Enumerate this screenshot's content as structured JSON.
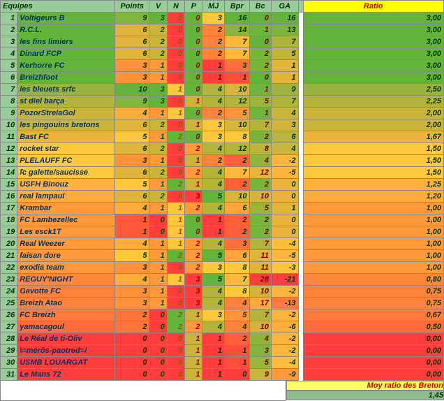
{
  "headers": {
    "equipes": "Equipes",
    "points": "Points",
    "v": "V",
    "n": "N",
    "p": "P",
    "mj": "MJ",
    "bpr": "Bpr",
    "bc": "Bc",
    "ga": "GA",
    "ratio": "Ratio"
  },
  "footer": {
    "label": "Moy ratio des Breton",
    "value": "1,45"
  },
  "rows": [
    {
      "n": 1,
      "team": "Voltigeurs B",
      "pts": 9,
      "v": 3,
      "nul": 0,
      "p": 0,
      "mj": 3,
      "bpr": 16,
      "bc": 0,
      "ga": 16,
      "ratio": "3,00"
    },
    {
      "n": 2,
      "team": "R.C.L.",
      "pts": 6,
      "v": 2,
      "nul": 0,
      "p": 0,
      "mj": 2,
      "bpr": 14,
      "bc": 1,
      "ga": 13,
      "ratio": "3,00"
    },
    {
      "n": 3,
      "team": "les fins limiers",
      "pts": 6,
      "v": 2,
      "nul": 0,
      "p": 0,
      "mj": 2,
      "bpr": 7,
      "bc": 0,
      "ga": 7,
      "ratio": "3,00"
    },
    {
      "n": 4,
      "team": "Dinard FCP",
      "pts": 6,
      "v": 2,
      "nul": 0,
      "p": 0,
      "mj": 2,
      "bpr": 7,
      "bc": 2,
      "ga": 5,
      "ratio": "3,00"
    },
    {
      "n": 5,
      "team": "Kerhorre FC",
      "pts": 3,
      "v": 1,
      "nul": 0,
      "p": 0,
      "mj": 1,
      "bpr": 3,
      "bc": 2,
      "ga": 1,
      "ratio": "3,00"
    },
    {
      "n": 6,
      "team": "Breizhfoot",
      "pts": 3,
      "v": 1,
      "nul": 0,
      "p": 0,
      "mj": 1,
      "bpr": 1,
      "bc": 0,
      "ga": 1,
      "ratio": "3,00"
    },
    {
      "n": 7,
      "team": "les bleuets srfc",
      "pts": 10,
      "v": 3,
      "nul": 1,
      "p": 0,
      "mj": 4,
      "bpr": 10,
      "bc": 1,
      "ga": 9,
      "ratio": "2,50"
    },
    {
      "n": 8,
      "team": "st diel barça",
      "pts": 9,
      "v": 3,
      "nul": 0,
      "p": 1,
      "mj": 4,
      "bpr": 12,
      "bc": 5,
      "ga": 7,
      "ratio": "2,25"
    },
    {
      "n": 9,
      "team": "PozorStrelaGol",
      "pts": 4,
      "v": 1,
      "nul": 1,
      "p": 0,
      "mj": 2,
      "bpr": 5,
      "bc": 1,
      "ga": 4,
      "ratio": "2,00"
    },
    {
      "n": 10,
      "team": "les pingouins bretons",
      "pts": 6,
      "v": 2,
      "nul": 0,
      "p": 1,
      "mj": 3,
      "bpr": 10,
      "bc": 7,
      "ga": 3,
      "ratio": "2,00"
    },
    {
      "n": 11,
      "team": "Bast FC",
      "pts": 5,
      "v": 1,
      "nul": 2,
      "p": 0,
      "mj": 3,
      "bpr": 8,
      "bc": 2,
      "ga": 6,
      "ratio": "1,67"
    },
    {
      "n": 12,
      "team": "rocket star",
      "pts": 6,
      "v": 2,
      "nul": 0,
      "p": 2,
      "mj": 4,
      "bpr": 12,
      "bc": 8,
      "ga": 4,
      "ratio": "1,50"
    },
    {
      "n": 13,
      "team": "PLELAUFF FC",
      "pts": 3,
      "v": 1,
      "nul": 0,
      "p": 1,
      "mj": 2,
      "bpr": 2,
      "bc": 4,
      "ga": -2,
      "ratio": "1,50"
    },
    {
      "n": 14,
      "team": "fc galette/saucisse",
      "pts": 6,
      "v": 2,
      "nul": 0,
      "p": 2,
      "mj": 4,
      "bpr": 7,
      "bc": 12,
      "ga": -5,
      "ratio": "1,50"
    },
    {
      "n": 15,
      "team": "USFH Binouz",
      "pts": 5,
      "v": 1,
      "nul": 2,
      "p": 1,
      "mj": 4,
      "bpr": 2,
      "bc": 2,
      "ga": 0,
      "ratio": "1,25"
    },
    {
      "n": 16,
      "team": "real lampaul",
      "pts": 6,
      "v": 2,
      "nul": 0,
      "p": 3,
      "mj": 5,
      "bpr": 10,
      "bc": 10,
      "ga": 0,
      "ratio": "1,20"
    },
    {
      "n": 17,
      "team": "Krambar",
      "pts": 4,
      "v": 1,
      "nul": 1,
      "p": 2,
      "mj": 4,
      "bpr": 6,
      "bc": 5,
      "ga": 1,
      "ratio": "1,00"
    },
    {
      "n": 18,
      "team": "FC Lambezellec",
      "pts": 1,
      "v": 0,
      "nul": 1,
      "p": 0,
      "mj": 1,
      "bpr": 2,
      "bc": 2,
      "ga": 0,
      "ratio": "1,00"
    },
    {
      "n": 19,
      "team": "Les esck1T",
      "pts": 1,
      "v": 0,
      "nul": 1,
      "p": 0,
      "mj": 1,
      "bpr": 2,
      "bc": 2,
      "ga": 0,
      "ratio": "1,00"
    },
    {
      "n": 20,
      "team": "Real Weezer",
      "pts": 4,
      "v": 1,
      "nul": 1,
      "p": 2,
      "mj": 4,
      "bpr": 3,
      "bc": 7,
      "ga": -4,
      "ratio": "1,00"
    },
    {
      "n": 21,
      "team": "faisan dore",
      "pts": 5,
      "v": 1,
      "nul": 2,
      "p": 2,
      "mj": 5,
      "bpr": 6,
      "bc": 11,
      "ga": -5,
      "ratio": "1,00"
    },
    {
      "n": 22,
      "team": "exodia team",
      "pts": 3,
      "v": 1,
      "nul": 0,
      "p": 2,
      "mj": 3,
      "bpr": 8,
      "bc": 11,
      "ga": -3,
      "ratio": "1,00"
    },
    {
      "n": 23,
      "team": "REGUY'NIGHT",
      "pts": 4,
      "v": 1,
      "nul": 1,
      "p": 3,
      "mj": 5,
      "bpr": 7,
      "bc": 28,
      "ga": -21,
      "ratio": "0,80"
    },
    {
      "n": 24,
      "team": "Gavotte FC",
      "pts": 3,
      "v": 1,
      "nul": 0,
      "p": 3,
      "mj": 4,
      "bpr": 8,
      "bc": 10,
      "ga": -2,
      "ratio": "0,75"
    },
    {
      "n": 25,
      "team": "Breizh Atao",
      "pts": 3,
      "v": 1,
      "nul": 0,
      "p": 3,
      "mj": 4,
      "bpr": 4,
      "bc": 17,
      "ga": -13,
      "ratio": "0,75"
    },
    {
      "n": 26,
      "team": "FC Breizh",
      "pts": 2,
      "v": 0,
      "nul": 2,
      "p": 1,
      "mj": 3,
      "bpr": 5,
      "bc": 7,
      "ga": -2,
      "ratio": "0,67"
    },
    {
      "n": 27,
      "team": "yamacagoul",
      "pts": 2,
      "v": 0,
      "nul": 2,
      "p": 2,
      "mj": 4,
      "bpr": 4,
      "bc": 10,
      "ga": -6,
      "ratio": "0,50"
    },
    {
      "n": 28,
      "team": "  Le Réal de ti-Oliv",
      "pts": 0,
      "v": 0,
      "nul": 0,
      "p": 1,
      "mj": 1,
      "bpr": 2,
      "bc": 4,
      "ga": -2,
      "ratio": "0,00"
    },
    {
      "n": 29,
      "team": "  \\=mérôs-paotred=/",
      "pts": 0,
      "v": 0,
      "nul": 0,
      "p": 1,
      "mj": 1,
      "bpr": 1,
      "bc": 3,
      "ga": -2,
      "ratio": "0,00"
    },
    {
      "n": 30,
      "team": "USMB LOUARGAT",
      "pts": 0,
      "v": 0,
      "nul": 0,
      "p": 1,
      "mj": 1,
      "bpr": 1,
      "bc": 5,
      "ga": -4,
      "ratio": "0,00"
    },
    {
      "n": 31,
      "team": "Le Mans 72",
      "pts": 0,
      "v": 0,
      "nul": 0,
      "p": 1,
      "mj": 1,
      "bpr": 0,
      "bc": 9,
      "ga": -9,
      "ratio": "0,00"
    }
  ]
}
